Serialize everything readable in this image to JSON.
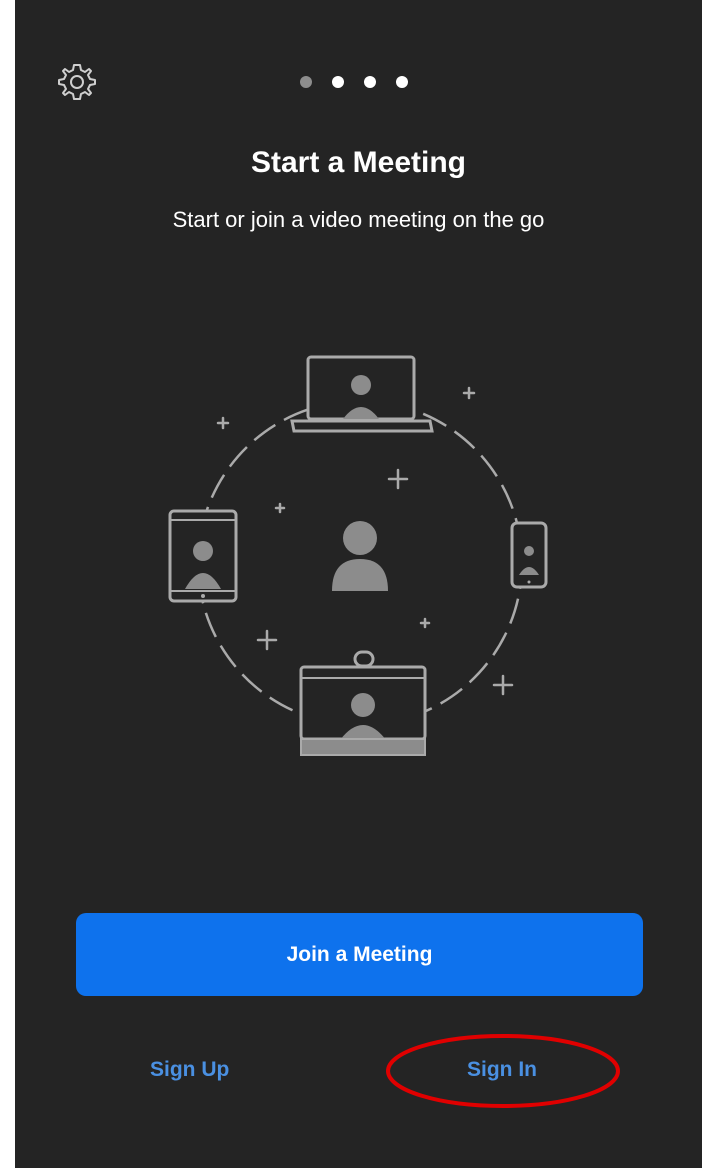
{
  "header": {
    "settings_icon": "gear-icon",
    "pager": {
      "total": 4,
      "active_index": 1
    }
  },
  "main": {
    "title": "Start a Meeting",
    "subtitle": "Start or join a video meeting on the go",
    "illustration_icon": "video-meeting-devices-illustration"
  },
  "actions": {
    "join_label": "Join a Meeting",
    "sign_up_label": "Sign Up",
    "sign_in_label": "Sign In"
  },
  "annotation": {
    "highlight_color": "#e00000",
    "highlight_target": "sign-in-link"
  },
  "colors": {
    "background": "#242424",
    "primary_button": "#0e72ed",
    "link": "#4a90e2",
    "illustration_stroke": "#aaaaaa",
    "illustration_fill": "#8c8c8c"
  }
}
